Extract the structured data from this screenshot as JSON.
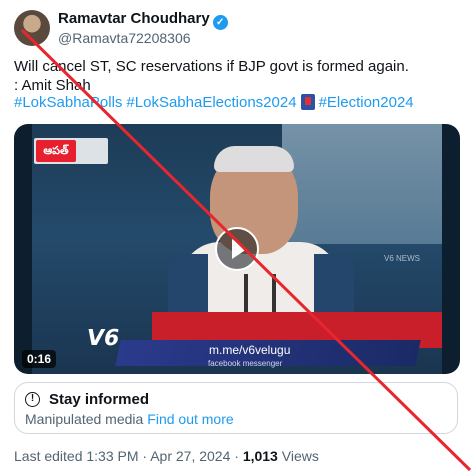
{
  "author": {
    "display_name": "Ramavtar Choudhary",
    "handle": "@Ramavta72208306",
    "verified_icon": "verified-badge-icon",
    "verified_glyph": "✓"
  },
  "tweet": {
    "line1": "Will cancel ST, SC reservations if BJP govt is formed again.",
    "line2": ": Amit Shah",
    "hashtags": [
      "#LokSabhaPolls",
      "#LokSabhaElections2024",
      "#Election2024"
    ],
    "emoji_icon": "election-ballot-emoji-icon"
  },
  "video": {
    "duration": "0:16",
    "channel_logo_text": "V6",
    "ticker_text": "m.me/v6velugu",
    "ticker_sub": "facebook messenger",
    "top_logo_text": "ఆపత్",
    "watermark_text": "V6 NEWS",
    "play_icon": "play-icon"
  },
  "notice": {
    "title": "Stay informed",
    "body": "Manipulated media",
    "link": "Find out more",
    "icon": "info-icon",
    "icon_glyph": "!"
  },
  "meta": {
    "edited": "Last edited 1:33 PM · Apr 27, 2024 · ",
    "views_count": "1,013",
    "views_label": " Views"
  },
  "overlay": {
    "strike_color": "#e8262e",
    "icon": "red-strike-cross-icon"
  },
  "colors": {
    "link": "#1d9bf0",
    "text": "#0f1419",
    "secondary": "#536471",
    "border": "#cfd9de"
  }
}
